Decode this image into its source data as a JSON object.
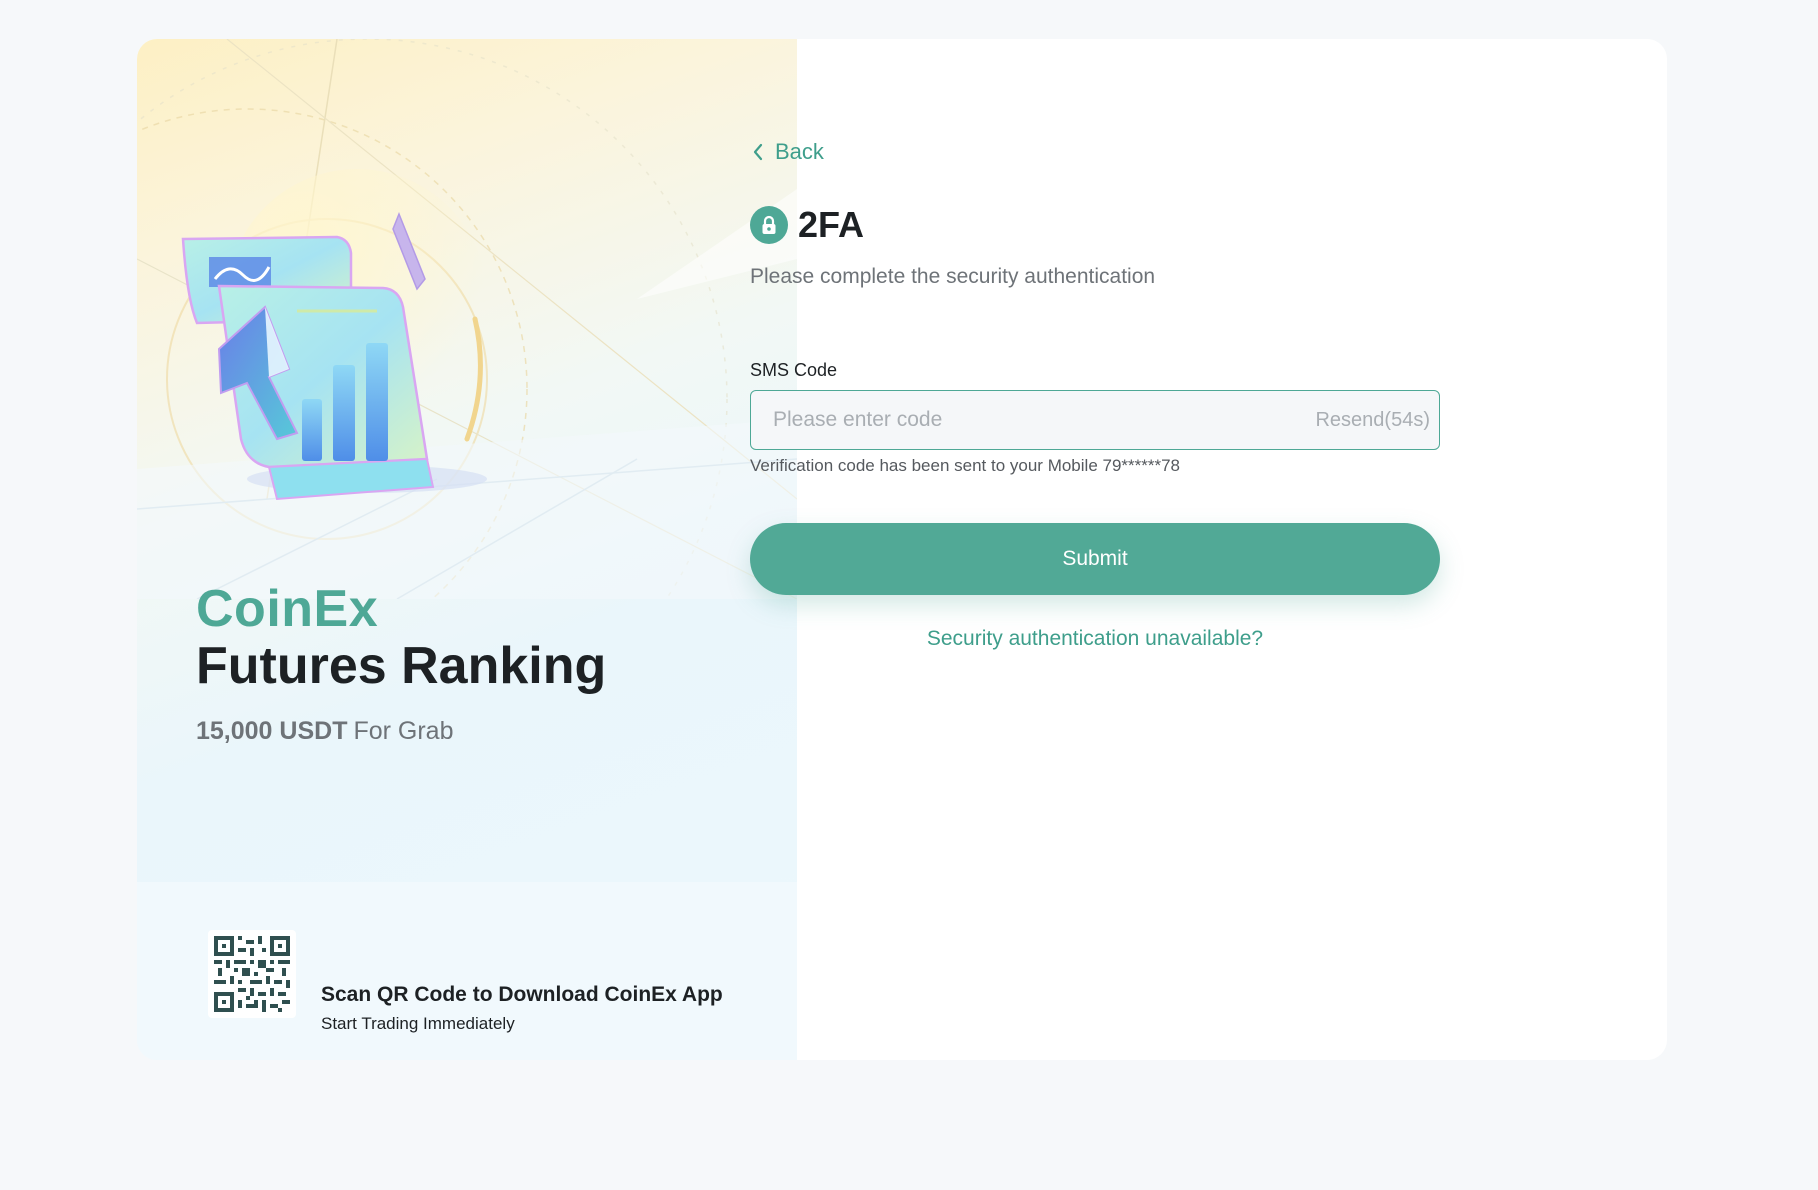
{
  "promo": {
    "brand": "CoinEx",
    "title": "Futures Ranking",
    "prize_amount": "15,000 USDT",
    "prize_suffix": "For Grab",
    "qr_title": "Scan QR Code to Download CoinEx App",
    "qr_subtitle": "Start Trading Immediately"
  },
  "form": {
    "back_label": "Back",
    "heading": "2FA",
    "subtitle": "Please complete the security authentication",
    "field_label": "SMS Code",
    "input_value": "",
    "input_placeholder": "Please enter code",
    "resend_label": "Resend(54s)",
    "hint": "Verification code has been sent to your Mobile 79******78",
    "submit_label": "Submit",
    "unavailable_link": "Security authentication unavailable?"
  },
  "icons": {
    "back": "chevron-left-icon",
    "lock": "lock-icon",
    "qr": "qr-code-icon"
  },
  "colors": {
    "accent": "#4ea896",
    "accent_text": "#3e9e8b",
    "heading": "#1d2124",
    "muted": "#6e7378",
    "placeholder": "#a9aeb3",
    "page_bg": "#f6f8fa"
  }
}
